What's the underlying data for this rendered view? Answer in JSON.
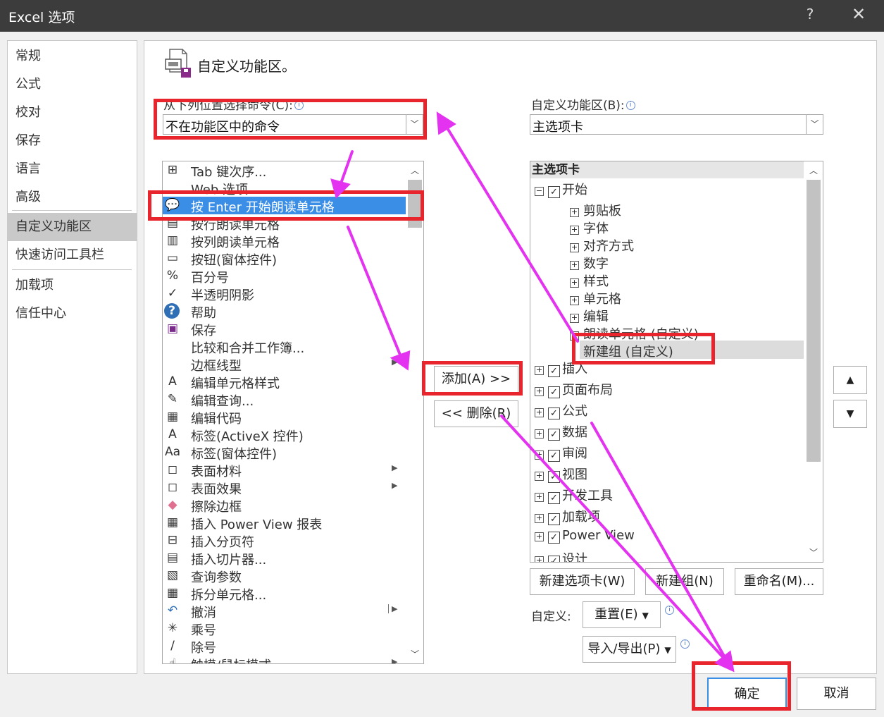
{
  "window": {
    "title": "Excel 选项",
    "help": "?",
    "close": "✕"
  },
  "nav": {
    "items": [
      {
        "label": "常规"
      },
      {
        "label": "公式"
      },
      {
        "label": "校对"
      },
      {
        "label": "保存"
      },
      {
        "label": "语言"
      },
      {
        "label": "高级"
      },
      {
        "label": "自定义功能区",
        "active": true
      },
      {
        "label": "快速访问工具栏"
      },
      {
        "label": "加载项"
      },
      {
        "label": "信任中心"
      }
    ]
  },
  "heading": "自定义功能区。",
  "left_panel": {
    "label": "从下列位置选择命令(C):",
    "combo_value": "不在功能区中的命令",
    "commands": [
      {
        "label": "Tab 键次序...",
        "icon": "tab-order-icon",
        "glyph": "⊞"
      },
      {
        "label": "Web 选项",
        "icon": "web-options-icon",
        "glyph": ""
      },
      {
        "label": "按 Enter 开始朗读单元格",
        "icon": "speak-enter-icon",
        "glyph": "💬",
        "selected": true
      },
      {
        "label": "按行朗读单元格",
        "icon": "speak-rows-icon",
        "glyph": "▤"
      },
      {
        "label": "按列朗读单元格",
        "icon": "speak-columns-icon",
        "glyph": "▥"
      },
      {
        "label": "按钮(窗体控件)",
        "icon": "button-control-icon",
        "glyph": "▭"
      },
      {
        "label": "百分号",
        "icon": "percent-icon",
        "glyph": "%"
      },
      {
        "label": "半透明阴影",
        "icon": "check-icon",
        "glyph": "✓"
      },
      {
        "label": "帮助",
        "icon": "help-icon",
        "glyph": "?"
      },
      {
        "label": "保存",
        "icon": "save-icon",
        "glyph": "▣"
      },
      {
        "label": "比较和合并工作簿...",
        "icon": "compare-icon",
        "glyph": ""
      },
      {
        "label": "边框线型",
        "icon": "border-style-icon",
        "glyph": "",
        "submenu": true
      },
      {
        "label": "编辑单元格样式",
        "icon": "cell-style-icon",
        "glyph": "A"
      },
      {
        "label": "编辑查询...",
        "icon": "edit-query-icon",
        "glyph": "✎"
      },
      {
        "label": "编辑代码",
        "icon": "edit-code-icon",
        "glyph": "▦"
      },
      {
        "label": "标签(ActiveX 控件)",
        "icon": "label-activex-icon",
        "glyph": "A"
      },
      {
        "label": "标签(窗体控件)",
        "icon": "label-form-icon",
        "glyph": "Aa"
      },
      {
        "label": "表面材料",
        "icon": "surface-material-icon",
        "glyph": "◻",
        "submenu": true
      },
      {
        "label": "表面效果",
        "icon": "surface-effect-icon",
        "glyph": "◻",
        "submenu": true
      },
      {
        "label": "擦除边框",
        "icon": "eraser-icon",
        "glyph": "◆"
      },
      {
        "label": "插入 Power View 报表",
        "icon": "power-view-icon",
        "glyph": "▦"
      },
      {
        "label": "插入分页符",
        "icon": "page-break-icon",
        "glyph": "⊟"
      },
      {
        "label": "插入切片器...",
        "icon": "slicer-icon",
        "glyph": "▤"
      },
      {
        "label": "查询参数",
        "icon": "query-params-icon",
        "glyph": "▧"
      },
      {
        "label": "拆分单元格...",
        "icon": "split-cells-icon",
        "glyph": "▦"
      },
      {
        "label": "撤消",
        "icon": "undo-icon",
        "glyph": "↶",
        "submenu_bar": true
      },
      {
        "label": "乘号",
        "icon": "multiply-icon",
        "glyph": "✳"
      },
      {
        "label": "除号",
        "icon": "divide-icon",
        "glyph": "/"
      },
      {
        "label": "触摸/鼠标模式",
        "icon": "touch-mode-icon",
        "glyph": "☝",
        "submenu": true
      }
    ]
  },
  "middle": {
    "add": "添加(A) >>",
    "remove": "<< 删除(R)"
  },
  "right_panel": {
    "label": "自定义功能区(B):",
    "combo_value": "主选项卡",
    "tree_header": "主选项卡",
    "tree": [
      {
        "label": "开始",
        "level": 0,
        "expander": "−",
        "checked": true
      },
      {
        "label": "剪贴板",
        "level": 1,
        "expander": "+"
      },
      {
        "label": "字体",
        "level": 1,
        "expander": "+"
      },
      {
        "label": "对齐方式",
        "level": 1,
        "expander": "+"
      },
      {
        "label": "数字",
        "level": 1,
        "expander": "+"
      },
      {
        "label": "样式",
        "level": 1,
        "expander": "+"
      },
      {
        "label": "单元格",
        "level": 1,
        "expander": "+"
      },
      {
        "label": "编辑",
        "level": 1,
        "expander": "+"
      },
      {
        "label": "朗读单元格 (自定义)",
        "level": 1,
        "expander": "+"
      },
      {
        "label": "新建组 (自定义)",
        "level": 2,
        "selected": true
      },
      {
        "label": "插入",
        "level": 0,
        "expander": "+",
        "checked": true
      },
      {
        "label": "页面布局",
        "level": 0,
        "expander": "+",
        "checked": true
      },
      {
        "label": "公式",
        "level": 0,
        "expander": "+",
        "checked": true
      },
      {
        "label": "数据",
        "level": 0,
        "expander": "+",
        "checked": true
      },
      {
        "label": "审阅",
        "level": 0,
        "expander": "+",
        "checked": true
      },
      {
        "label": "视图",
        "level": 0,
        "expander": "+",
        "checked": true
      },
      {
        "label": "开发工具",
        "level": 0,
        "expander": "+",
        "checked": true
      },
      {
        "label": "加载项",
        "level": 0,
        "expander": "+",
        "checked": true
      },
      {
        "label": "Power View",
        "level": 0,
        "expander": "+",
        "checked": true
      },
      {
        "label": "设计",
        "level": 0,
        "expander": "+",
        "checked": true
      }
    ],
    "new_tab": "新建选项卡(W)",
    "new_group": "新建组(N)",
    "rename": "重命名(M)...",
    "customize_label": "自定义:",
    "reset": "重置(E)",
    "import_export": "导入/导出(P)"
  },
  "footer": {
    "ok": "确定",
    "cancel": "取消"
  },
  "colors": {
    "annotation_box": "#e8242c",
    "annotation_arrow": "#e433f0",
    "selection": "#3a8ee6"
  }
}
